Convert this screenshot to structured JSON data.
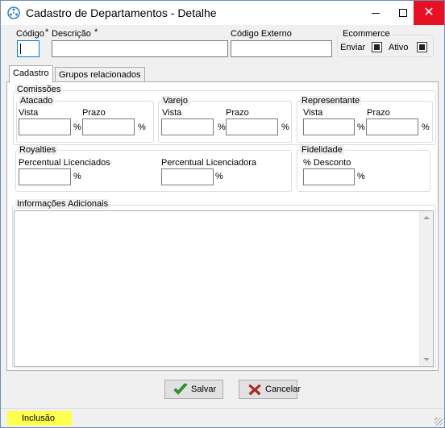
{
  "window": {
    "title": "Cadastro de Departamentos - Detalhe",
    "app_icon": "app-icon",
    "minimize_symbol": "",
    "maximize_symbol": "",
    "close_symbol": "✕"
  },
  "header": {
    "codigo_label": "Código",
    "codigo_required": "*",
    "codigo_value": "",
    "descricao_label": "Descrição",
    "descricao_required": "*",
    "descricao_value": "",
    "codigo_externo_label": "Código Externo",
    "codigo_externo_value": "",
    "ecommerce": {
      "group_label": "Ecommerce",
      "enviar_label": "Enviar",
      "enviar_checked": true,
      "ativo_label": "Ativo",
      "ativo_checked": true
    }
  },
  "tabs": [
    {
      "label": "Cadastro",
      "active": true
    },
    {
      "label": "Grupos relacionados",
      "active": false
    }
  ],
  "cadastro": {
    "comissoes": {
      "group_label": "Comissões",
      "atacado": {
        "label": "Atacado",
        "vista_label": "Vista",
        "prazo_label": "Prazo",
        "vista_value": "",
        "prazo_value": "",
        "unit": "%"
      },
      "varejo": {
        "label": "Varejo",
        "vista_label": "Vista",
        "prazo_label": "Prazo",
        "vista_value": "",
        "prazo_value": "",
        "unit": "%"
      },
      "representante": {
        "label": "Representante",
        "vista_label": "Vista",
        "prazo_label": "Prazo",
        "vista_value": "",
        "prazo_value": "",
        "unit": "%"
      }
    },
    "royalties": {
      "group_label": "Royalties",
      "licenciados_label": "Percentual Licenciados",
      "licenciados_value": "",
      "licenciadora_label": "Percentual Licenciadora",
      "licenciadora_value": "",
      "unit": "%"
    },
    "fidelidade": {
      "group_label": "Fidelidade",
      "desconto_label": "% Desconto",
      "desconto_value": "",
      "unit": "%"
    },
    "informacoes": {
      "group_label": "Informações Adicionais",
      "value": ""
    }
  },
  "footer": {
    "save_label": "Salvar",
    "save_icon": "checkmark-icon",
    "cancel_label": "Cancelar",
    "cancel_icon": "x-icon"
  },
  "status": {
    "mode": "Inclusão",
    "mode_color": "#ffff4d"
  }
}
